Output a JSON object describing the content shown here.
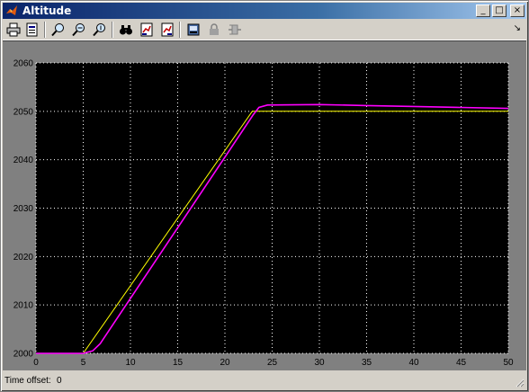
{
  "window": {
    "title": "Altitude"
  },
  "title_buttons": {
    "minimize": "_",
    "maximize": "□",
    "close": "×"
  },
  "toolbar": {
    "items": [
      "print-icon",
      "print-setup-icon",
      "zoom-icon",
      "zoom-x-icon",
      "zoom-y-icon",
      "autoscale-icon",
      "save-axes-icon",
      "restore-axes-icon",
      "scope-params-icon",
      "lock-axes-icon",
      "signal-selection-icon"
    ],
    "corner_arrow": "↘"
  },
  "status": {
    "label": "Time offset:",
    "value": "0"
  },
  "colors": {
    "background": "#000000",
    "grid": "#ffffff",
    "axis_text": "#000000",
    "series_yellow": "#ffff00",
    "series_magenta": "#ff00ff"
  },
  "chart_data": {
    "type": "line",
    "title": "",
    "xlabel": "",
    "ylabel": "",
    "xlim": [
      0,
      50
    ],
    "ylim": [
      2000,
      2060
    ],
    "xticks": [
      0,
      5,
      10,
      15,
      20,
      25,
      30,
      35,
      40,
      45,
      50
    ],
    "yticks": [
      2000,
      2010,
      2020,
      2030,
      2040,
      2050,
      2060
    ],
    "grid": true,
    "series": [
      {
        "color": "#ffff00",
        "x": [
          0,
          5,
          22.9,
          24,
          30,
          40,
          50
        ],
        "y": [
          2000,
          2000,
          2050,
          2050,
          2050,
          2050,
          2050
        ]
      },
      {
        "color": "#ff00ff",
        "x": [
          0,
          5,
          6,
          6.8,
          23,
          23.6,
          24.5,
          30,
          35,
          40,
          45,
          50
        ],
        "y": [
          2000,
          2000,
          2000.5,
          2002,
          2049.3,
          2050.8,
          2051.3,
          2051.4,
          2051.2,
          2051.0,
          2050.8,
          2050.6
        ]
      }
    ]
  }
}
